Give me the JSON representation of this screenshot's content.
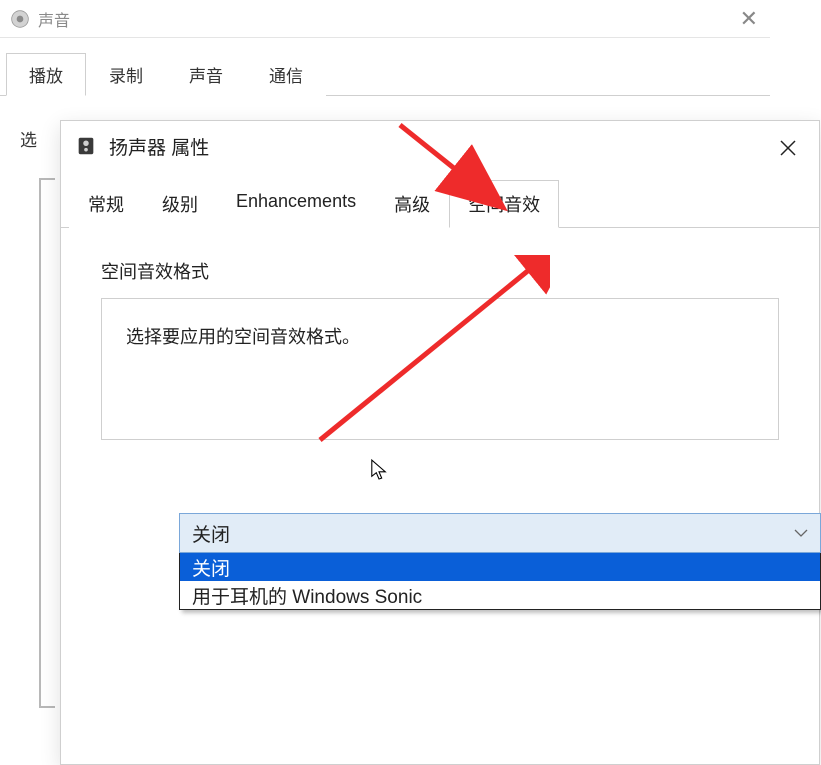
{
  "sound_window": {
    "title": "声音",
    "tabs": [
      "播放",
      "录制",
      "声音",
      "通信"
    ],
    "active_tab_index": 0,
    "label_select": "选"
  },
  "properties_window": {
    "title": "扬声器 属性",
    "tabs": [
      "常规",
      "级别",
      "Enhancements",
      "高级",
      "空间音效"
    ],
    "active_tab_index": 4,
    "group_label": "空间音效格式",
    "instructions": "选择要应用的空间音效格式。",
    "dropdown": {
      "selected": "关闭",
      "options": [
        "关闭",
        "用于耳机的 Windows Sonic"
      ],
      "highlighted_index": 0
    }
  }
}
